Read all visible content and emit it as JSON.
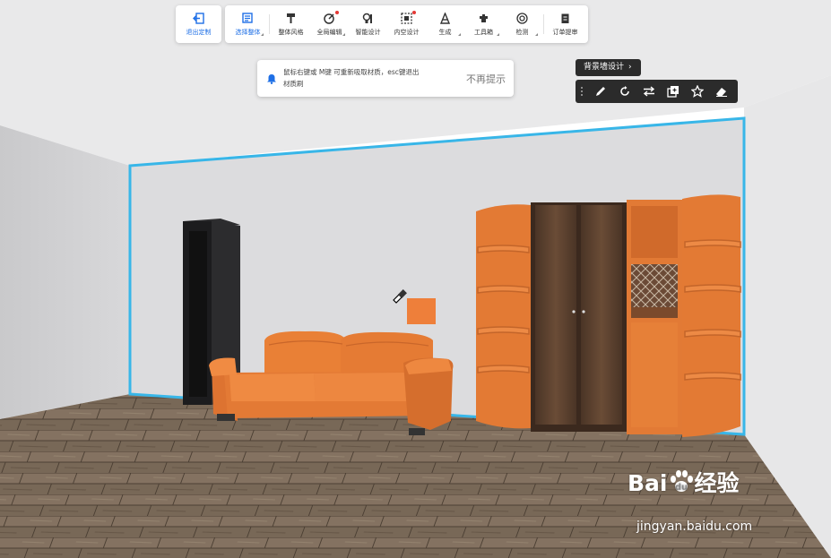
{
  "toolbar": {
    "items": [
      {
        "label": "退出定制",
        "icon": "exit-icon"
      },
      {
        "label": "选择整体",
        "icon": "select-whole-icon"
      },
      {
        "label": "整体风格",
        "icon": "style-brush-icon"
      },
      {
        "label": "全局编辑",
        "icon": "global-edit-icon"
      },
      {
        "label": "智能设计",
        "icon": "smart-design-icon"
      },
      {
        "label": "内空设计",
        "icon": "interior-design-icon"
      },
      {
        "label": "生成",
        "icon": "generate-icon"
      },
      {
        "label": "工具箱",
        "icon": "toolbox-icon"
      },
      {
        "label": "检测",
        "icon": "inspect-icon"
      },
      {
        "label": "订单提审",
        "icon": "order-submit-icon"
      }
    ],
    "accent": "#1e6fe6"
  },
  "hint": {
    "line1": "鼠标右键或 M键 可重新吸取材质，esc键退出",
    "line2": "材质刷",
    "dismiss": "不再提示"
  },
  "panel": {
    "title": "背景墙设计",
    "chevron": "›",
    "tools": [
      "pencil-icon",
      "rotate-icon",
      "swap-icon",
      "copy-icon",
      "star-icon",
      "eraser-icon"
    ]
  },
  "colors": {
    "material_orange": "#ee7f3a",
    "selection_outline": "#38b6e8",
    "wall": "#dcdcde",
    "floor": "#7a6a59"
  },
  "watermark": {
    "logo_left": "Bai",
    "logo_right": "经验",
    "url": "jingyan.baidu.com"
  }
}
